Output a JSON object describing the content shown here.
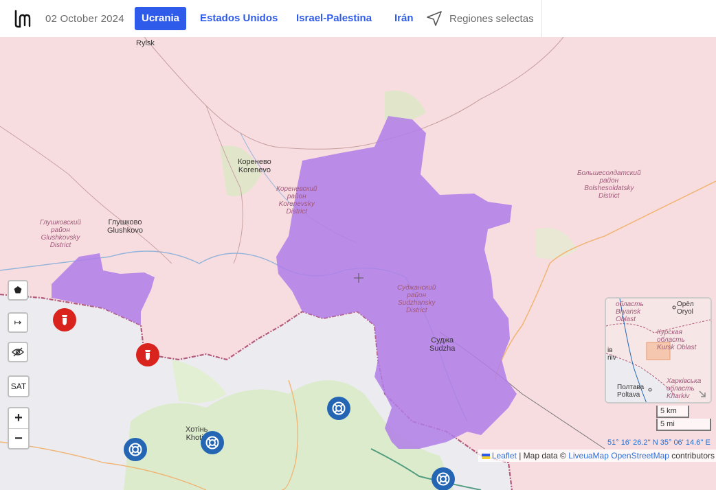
{
  "header": {
    "date": "02 October 2024",
    "nav": [
      {
        "label": "Ucrania",
        "active": true
      },
      {
        "label": "Estados Unidos",
        "active": false
      },
      {
        "label": "Israel-Palestina",
        "active": false
      },
      {
        "label": "Irán",
        "active": false
      }
    ],
    "regions_label": "Regiones selectas"
  },
  "map": {
    "place_labels": [
      {
        "name": "Rylsk"
      },
      {
        "name": "Коренево\nKorenevo"
      },
      {
        "name": "Глушково\nGlushkovo"
      },
      {
        "name": "Суджа\nSudzha"
      },
      {
        "name": "Хотінь\nKhotin"
      }
    ],
    "district_labels": [
      {
        "name": "Кореневский\nрайон\nKorenevsky\nDistrict"
      },
      {
        "name": "Глушковский\nрайон\nGlushkovsky\nDistrict"
      },
      {
        "name": "Суджанский\nрайон\nSudzhansky\nDistrict"
      },
      {
        "name": "Большесолдатский\nрайон\nBolshesoldatsky\nDistrict"
      }
    ],
    "controls": {
      "draw_label": "⬟",
      "measure_label": "↦",
      "hide_label": "👁",
      "sat_label": "SAT",
      "zoom_in": "+",
      "zoom_out": "−"
    },
    "minimap_labels": [
      {
        "name": "область\nBryansk\nOblast"
      },
      {
        "name": "Орёл\nOryol"
      },
      {
        "name": "Курская\nобласть\nKursk Oblast"
      },
      {
        "name": "Полтава\nPoltava"
      },
      {
        "name": "Харківська\nобласть\nKharkiv"
      },
      {
        "name": "ів\nniv"
      }
    ],
    "scale_km": "5 km",
    "scale_mi": "5 mi",
    "coordinates": "51° 16' 26.2'' N 35° 06' 14.6'' E",
    "attribution": {
      "leaflet": "Leaflet",
      "map_data": " | Map data © ",
      "liveuamap": "LiveuaMap",
      "osm": "OpenStreetMap",
      "contributors": " contributors"
    },
    "colors": {
      "russia_fill": "#f8dde0",
      "ukraine_fill": "#ececf0",
      "occupied_fill": "#b07ee8",
      "border": "#b35a7a",
      "nav_accent": "#2f5bea",
      "marker_red": "#d9231d",
      "marker_blue": "#2466b3"
    }
  }
}
